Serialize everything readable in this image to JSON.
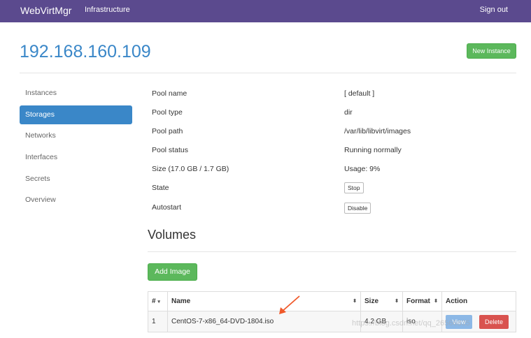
{
  "navbar": {
    "brand": "WebVirtMgr",
    "infrastructure": "Infrastructure",
    "signout": "Sign out"
  },
  "header": {
    "title": "192.168.160.109",
    "new_instance": "New Instance"
  },
  "sidebar": {
    "items": [
      {
        "label": "Instances"
      },
      {
        "label": "Storages"
      },
      {
        "label": "Networks"
      },
      {
        "label": "Interfaces"
      },
      {
        "label": "Secrets"
      },
      {
        "label": "Overview"
      }
    ],
    "active": "Storages"
  },
  "pool": {
    "rows": [
      {
        "label": "Pool name",
        "value": "[ default ]"
      },
      {
        "label": "Pool type",
        "value": "dir"
      },
      {
        "label": "Pool path",
        "value": "/var/lib/libvirt/images"
      },
      {
        "label": "Pool status",
        "value": "Running normally"
      },
      {
        "label": "Size (17.0 GB / 1.7 GB)",
        "value": "Usage: 9%"
      },
      {
        "label": "State",
        "value": "Stop"
      },
      {
        "label": "Autostart",
        "value": "Disable"
      }
    ]
  },
  "volumes": {
    "title": "Volumes",
    "add_image": "Add Image",
    "columns": [
      "#",
      "Name",
      "Size",
      "Format",
      "Action"
    ],
    "rows": [
      {
        "index": "1",
        "name": "CentOS-7-x86_64-DVD-1804.iso",
        "size": "4.2 GB",
        "format": "iso",
        "view": "View",
        "delete": "Delete"
      }
    ]
  },
  "watermark": "https://blog.csdn.net/qq_26566835",
  "colors": {
    "navbar": "#5b4a8e",
    "accent": "#3a87c8",
    "success": "#5cb85c",
    "danger": "#d9534f",
    "arrow": "#f0592a"
  }
}
